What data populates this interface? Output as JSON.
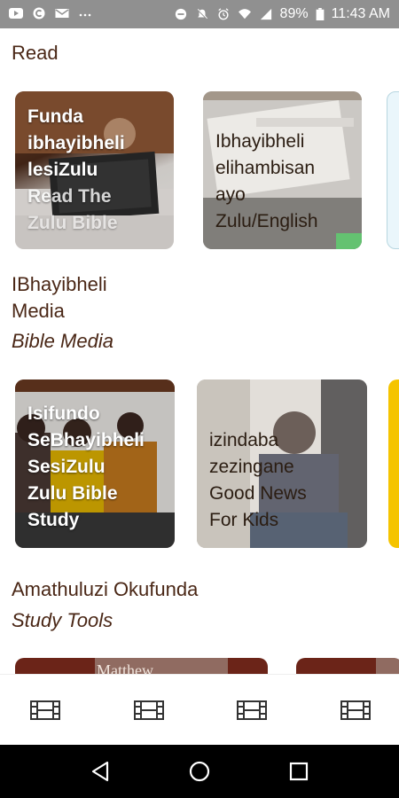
{
  "status_bar": {
    "battery": "89%",
    "time": "11:43 AM",
    "icons": [
      "youtube-icon",
      "c-app-icon",
      "mail-icon",
      "more-dots-icon",
      "do-not-disturb-icon",
      "mute-icon",
      "alarm-icon",
      "wifi-icon",
      "signal-icon",
      "battery-icon"
    ]
  },
  "sections": {
    "read": {
      "title": "Read"
    },
    "media": {
      "title": "IBhayibheli Media",
      "title_line1": "IBhayibheli",
      "title_line2": "Media",
      "subtitle": "Bible Media"
    },
    "tools": {
      "title": "Amathuluzi Okufunda",
      "subtitle": "Study Tools"
    }
  },
  "read_cards": [
    {
      "label_lines": [
        "Funda",
        "ibhayibheli",
        "lesiZulu",
        "Read The",
        "Zulu Bible"
      ]
    },
    {
      "label_lines": [
        "Ibhayibheli",
        "elihambisan",
        "ayo",
        "Zulu/English"
      ]
    }
  ],
  "media_cards": [
    {
      "label_lines": [
        "Isifundo",
        "SeBhayibheli",
        "SesiZulu",
        "Zulu Bible",
        "Study"
      ]
    },
    {
      "label_lines": [
        "izindaba",
        "zezingane",
        "Good News",
        "For Kids"
      ]
    }
  ],
  "tools_cards": [
    {
      "label": "Matthew"
    }
  ],
  "bottom_nav": {
    "items": [
      "film-icon",
      "film-icon",
      "film-icon",
      "film-icon"
    ]
  },
  "system_nav": [
    "back-icon",
    "home-icon",
    "recents-icon"
  ],
  "colors": {
    "heading": "#4a2716",
    "accent_yellow": "#f5c400",
    "card_brown": "#6b2418"
  }
}
